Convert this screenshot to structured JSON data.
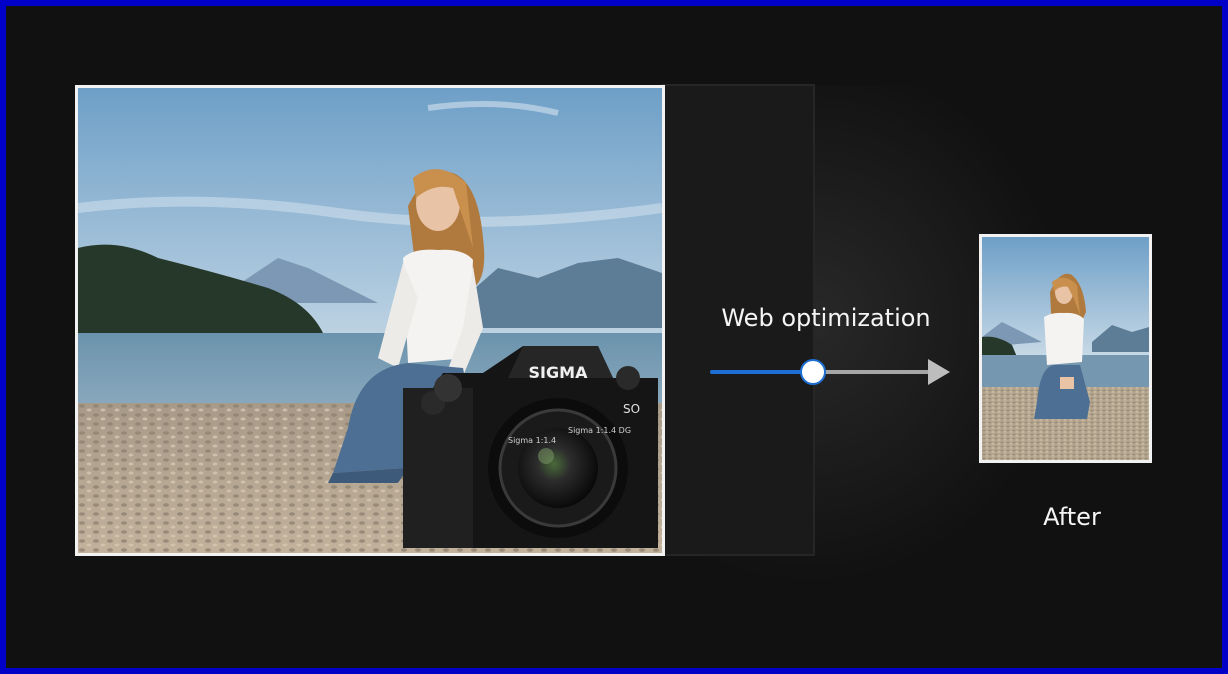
{
  "labels": {
    "process": "Web optimization",
    "result": "After"
  },
  "slider": {
    "progress": 0.47
  },
  "camera": {
    "brand": "SIGMA",
    "model": "SO",
    "lens_text_left": "Sigma 1:1.4",
    "lens_text_right": "Sigma 1:1.4 DG"
  },
  "colors": {
    "outer_border": "#0000c8",
    "background": "#111111",
    "accent": "#1e6fd4",
    "photo_border": "#f2f2f2"
  },
  "icons": {
    "arrow": "arrow-right-icon"
  }
}
